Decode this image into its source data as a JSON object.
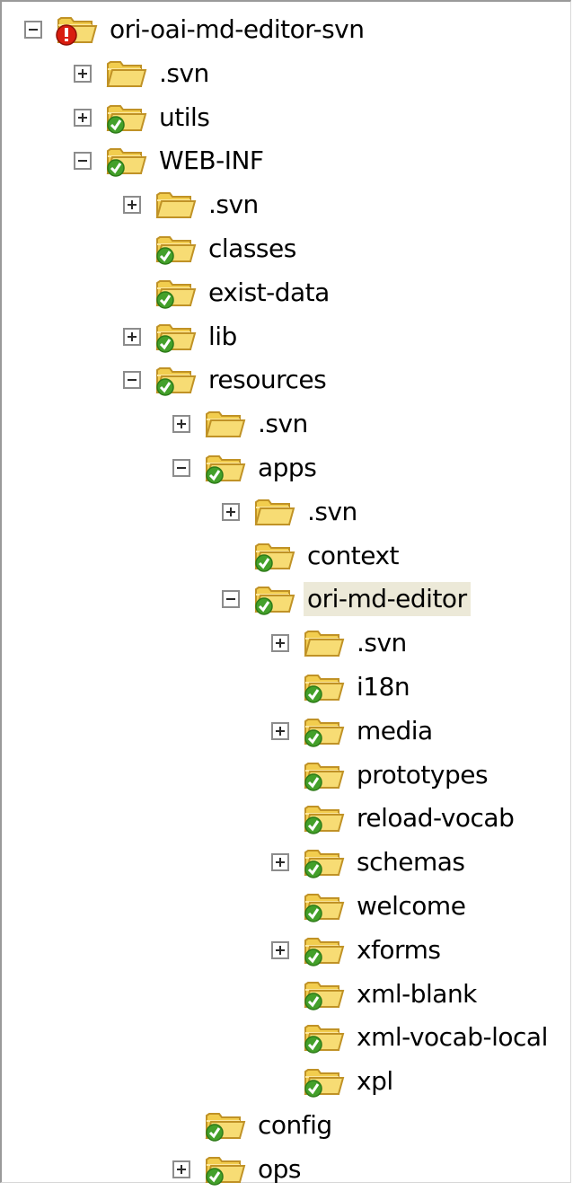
{
  "tree": {
    "nodes": [
      {
        "label": "ori-oai-md-editor-svn",
        "depth": 0,
        "expander": "minus",
        "status": "conflict"
      },
      {
        "label": ".svn",
        "depth": 1,
        "expander": "plus",
        "status": "plain"
      },
      {
        "label": "utils",
        "depth": 1,
        "expander": "plus",
        "status": "normal"
      },
      {
        "label": "WEB-INF",
        "depth": 1,
        "expander": "minus",
        "status": "normal"
      },
      {
        "label": ".svn",
        "depth": 2,
        "expander": "plus",
        "status": "plain"
      },
      {
        "label": "classes",
        "depth": 2,
        "expander": "none",
        "status": "normal"
      },
      {
        "label": "exist-data",
        "depth": 2,
        "expander": "none",
        "status": "normal"
      },
      {
        "label": "lib",
        "depth": 2,
        "expander": "plus",
        "status": "normal"
      },
      {
        "label": "resources",
        "depth": 2,
        "expander": "minus",
        "status": "normal"
      },
      {
        "label": ".svn",
        "depth": 3,
        "expander": "plus",
        "status": "plain"
      },
      {
        "label": "apps",
        "depth": 3,
        "expander": "minus",
        "status": "normal"
      },
      {
        "label": ".svn",
        "depth": 4,
        "expander": "plus",
        "status": "plain"
      },
      {
        "label": "context",
        "depth": 4,
        "expander": "none",
        "status": "normal"
      },
      {
        "label": "ori-md-editor",
        "depth": 4,
        "expander": "minus",
        "status": "normal",
        "selected": true
      },
      {
        "label": ".svn",
        "depth": 5,
        "expander": "plus",
        "status": "plain"
      },
      {
        "label": "i18n",
        "depth": 5,
        "expander": "none",
        "status": "normal"
      },
      {
        "label": "media",
        "depth": 5,
        "expander": "plus",
        "status": "normal"
      },
      {
        "label": "prototypes",
        "depth": 5,
        "expander": "none",
        "status": "normal"
      },
      {
        "label": "reload-vocab",
        "depth": 5,
        "expander": "none",
        "status": "normal"
      },
      {
        "label": "schemas",
        "depth": 5,
        "expander": "plus",
        "status": "normal"
      },
      {
        "label": "welcome",
        "depth": 5,
        "expander": "none",
        "status": "normal"
      },
      {
        "label": "xforms",
        "depth": 5,
        "expander": "plus",
        "status": "normal"
      },
      {
        "label": "xml-blank",
        "depth": 5,
        "expander": "none",
        "status": "normal"
      },
      {
        "label": "xml-vocab-local",
        "depth": 5,
        "expander": "none",
        "status": "normal"
      },
      {
        "label": "xpl",
        "depth": 5,
        "expander": "none",
        "status": "normal"
      },
      {
        "label": "config",
        "depth": 3,
        "expander": "none",
        "status": "normal"
      },
      {
        "label": "ops",
        "depth": 3,
        "expander": "plus",
        "status": "normal"
      }
    ]
  },
  "icons": {
    "plain": "folder-icon",
    "normal": "folder-svn-normal-icon",
    "conflict": "folder-svn-conflict-icon"
  },
  "colors": {
    "folder_body": "#f2cd4e",
    "folder_edge": "#c09226",
    "status_ok": "#43a02a",
    "status_conflict": "#d91c0f",
    "selection": "#ece9d8"
  }
}
